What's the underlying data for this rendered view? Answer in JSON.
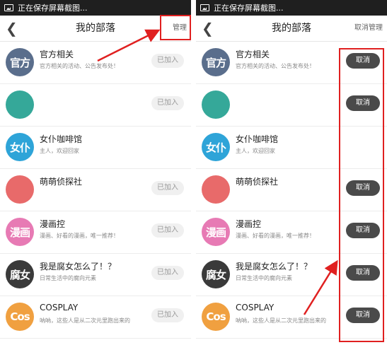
{
  "left": {
    "status": "正在保存屏幕截图...",
    "title": "我的部落",
    "manage_label": "管理",
    "rows": [
      {
        "avatar": "官方",
        "color": "#5a6e8c",
        "name": "官方相关",
        "desc": "官方相关的活动、公告发布处！",
        "action": "已加入"
      },
      {
        "avatar": "",
        "color": "#35a899",
        "name": "",
        "desc": "",
        "action": "已加入"
      },
      {
        "avatar": "女仆",
        "color": "#2ea4d8",
        "name": "女仆咖啡馆",
        "desc": "主人，欢迎回家",
        "action": ""
      },
      {
        "avatar": "",
        "color": "#e86a6a",
        "name": "萌萌侦探社",
        "desc": "",
        "action": "已加入"
      },
      {
        "avatar": "漫画",
        "color": "#e77ab4",
        "name": "漫画控",
        "desc": "漫画、好看的漫画，唯一推荐！",
        "action": "已加入"
      },
      {
        "avatar": "腐女",
        "color": "#3a3a3a",
        "name": "我是腐女怎么了！？",
        "desc": "日常生活中的腐向元素",
        "action": "已加入"
      },
      {
        "avatar": "Cos",
        "color": "#f0a040",
        "name": "COSPLAY",
        "desc": "呐呐，这些人是从二次元里跑出来的",
        "action": "已加入"
      }
    ]
  },
  "right": {
    "status": "正在保存屏幕截图...",
    "title": "我的部落",
    "manage_label": "取消管理",
    "rows": [
      {
        "avatar": "官方",
        "color": "#5a6e8c",
        "name": "官方相关",
        "desc": "官方相关的活动、公告发布处！",
        "action": "取消"
      },
      {
        "avatar": "",
        "color": "#35a899",
        "name": "",
        "desc": "",
        "action": "取消"
      },
      {
        "avatar": "女仆",
        "color": "#2ea4d8",
        "name": "女仆咖啡馆",
        "desc": "主人，欢迎回家",
        "action": ""
      },
      {
        "avatar": "",
        "color": "#e86a6a",
        "name": "萌萌侦探社",
        "desc": "",
        "action": "取消"
      },
      {
        "avatar": "漫画",
        "color": "#e77ab4",
        "name": "漫画控",
        "desc": "漫画、好看的漫画，唯一推荐！",
        "action": "取消"
      },
      {
        "avatar": "腐女",
        "color": "#3a3a3a",
        "name": "我是腐女怎么了！？",
        "desc": "日常生活中的腐向元素",
        "action": "取消"
      },
      {
        "avatar": "Cos",
        "color": "#f0a040",
        "name": "COSPLAY",
        "desc": "呐呐，这些人是从二次元里跑出来的",
        "action": "取消"
      }
    ]
  },
  "annotation_color": "#e02020"
}
